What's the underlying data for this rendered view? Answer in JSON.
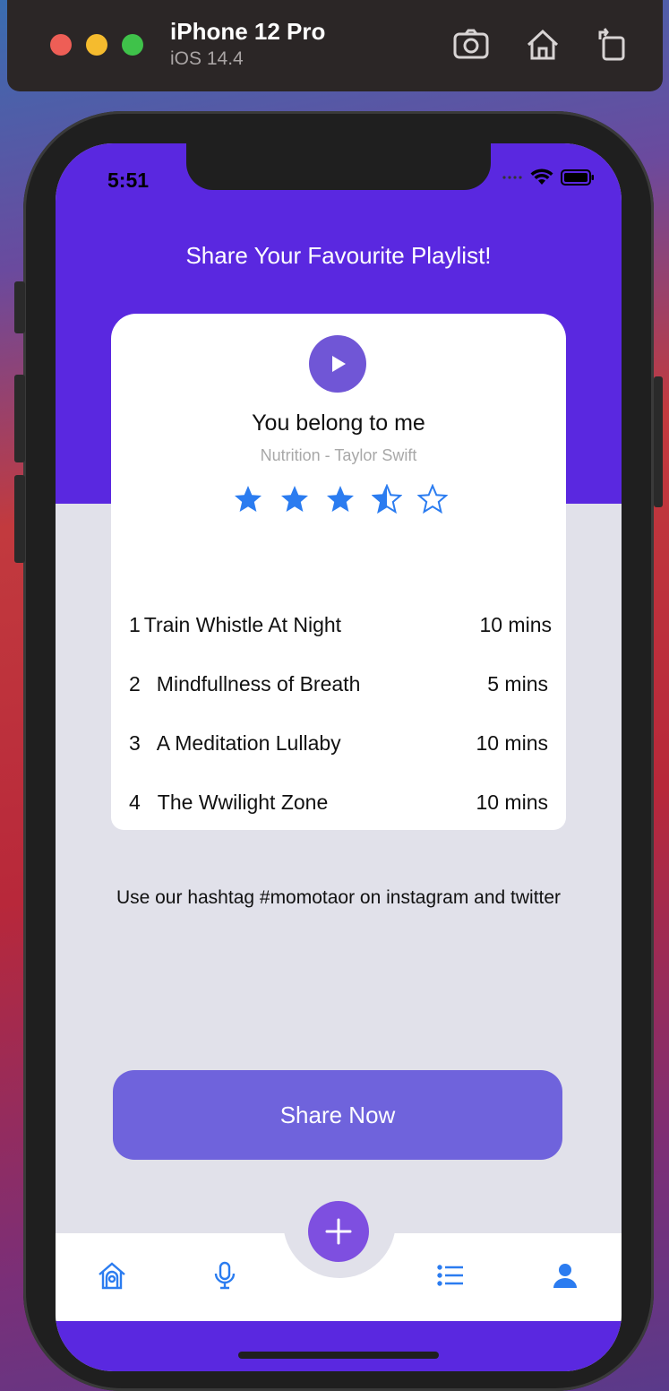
{
  "simulator": {
    "device_name": "iPhone 12 Pro",
    "os_version": "iOS 14.4",
    "toolbar_icons": [
      "screenshot-icon",
      "home-icon",
      "rotate-icon"
    ]
  },
  "status_bar": {
    "time": "5:51"
  },
  "app": {
    "title": "Share Your Favourite Playlist!",
    "now_playing": {
      "song_title": "You belong to me",
      "subtitle": "Nutrition - Taylor Swift",
      "rating": 3.5,
      "rating_max": 5
    },
    "tracks": [
      {
        "number": "1",
        "name": "Train Whistle At Night",
        "duration": "10 mins"
      },
      {
        "number": "2",
        "name": "Mindfullness of Breath",
        "duration": "5 mins"
      },
      {
        "number": "3",
        "name": "A Meditation Lullaby",
        "duration": "10 mins"
      },
      {
        "number": "4",
        "name": "The Wwilight Zone",
        "duration": "10 mins"
      }
    ],
    "hashtag_text": "Use our hashtag #momotaor on instagram and twitter",
    "share_button": "Share Now"
  },
  "tab_bar": {
    "items": [
      "home-icon",
      "microphone-icon",
      "add-icon",
      "list-icon",
      "profile-icon"
    ]
  },
  "colors": {
    "hero": "#5a28e0",
    "button": "#6f63dc",
    "accent_blue": "#2b7cf0",
    "background": "#e1e1ea"
  }
}
